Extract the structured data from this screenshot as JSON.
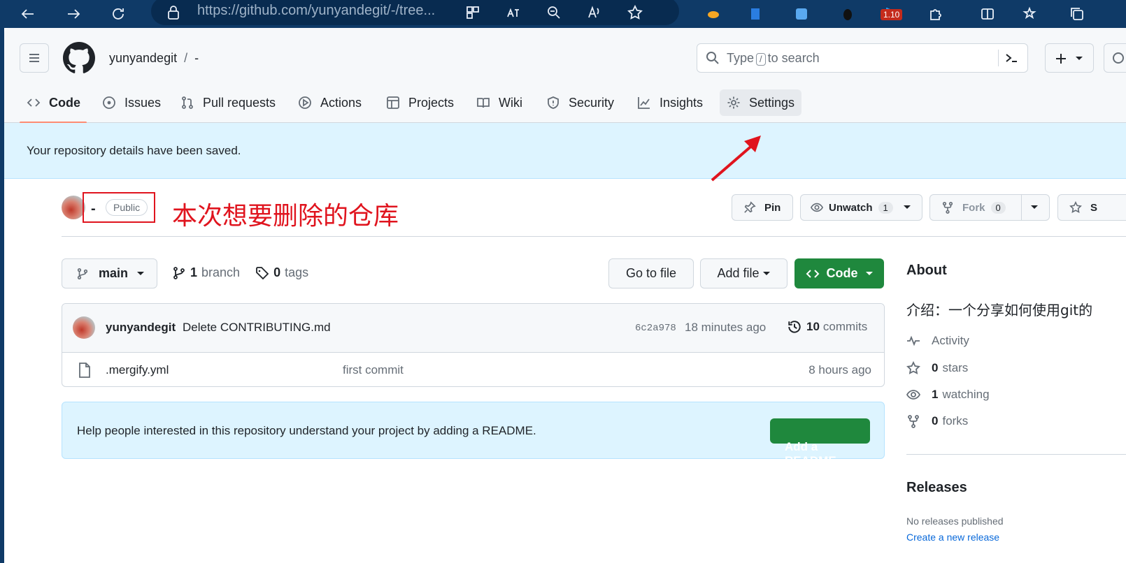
{
  "browser": {
    "url": "https://github.com/yunyandegit/-/tree...",
    "badge": "1.10"
  },
  "header": {
    "owner": "yunyandegit",
    "separator": "/",
    "repo": "-",
    "search_type": "Type",
    "search_key": "/",
    "search_suffix": "to search",
    "plus": "+"
  },
  "tabs": [
    {
      "label": "Code",
      "icon": "code-icon"
    },
    {
      "label": "Issues",
      "icon": "issue-icon"
    },
    {
      "label": "Pull requests",
      "icon": "pull-request-icon"
    },
    {
      "label": "Actions",
      "icon": "play-icon"
    },
    {
      "label": "Projects",
      "icon": "table-icon"
    },
    {
      "label": "Wiki",
      "icon": "book-icon"
    },
    {
      "label": "Security",
      "icon": "shield-icon"
    },
    {
      "label": "Insights",
      "icon": "graph-icon"
    },
    {
      "label": "Settings",
      "icon": "gear-icon"
    }
  ],
  "flash": "Your repository details have been saved.",
  "repo": {
    "name": "-",
    "visibility": "Public",
    "annotation": "本次想要删除的仓库",
    "pin": "Pin",
    "unwatch": "Unwatch",
    "watch_count": "1",
    "fork": "Fork",
    "fork_count": "0",
    "star": "S"
  },
  "toolbar": {
    "branch": "main",
    "branch_count": "1",
    "branch_word": "branch",
    "tag_count": "0",
    "tag_word": "tags",
    "go_to_file": "Go to file",
    "add_file": "Add file",
    "code": "Code"
  },
  "commit": {
    "author": "yunyandegit",
    "message": "Delete CONTRIBUTING.md",
    "hash": "6c2a978",
    "time": "18 minutes ago",
    "count": "10",
    "count_word": "commits"
  },
  "files": [
    {
      "name": ".mergify.yml",
      "message": "first commit",
      "time": "8 hours ago"
    }
  ],
  "readme": {
    "text": "Help people interested in this repository understand your project by adding a README.",
    "button": "Add a README"
  },
  "about": {
    "title": "About",
    "description": "介绍：一个分享如何使用git的",
    "activity": "Activity",
    "stars_count": "0",
    "stars_word": "stars",
    "watching_count": "1",
    "watching_word": "watching",
    "forks_count": "0",
    "forks_word": "forks"
  },
  "releases": {
    "title": "Releases",
    "none": "No releases published",
    "create": "Create a new release"
  },
  "colors": {
    "accent_green": "#1f883d",
    "annotation_red": "#e0141e",
    "flash_bg": "#ddf4ff",
    "browser_bar": "#0f3a67"
  }
}
